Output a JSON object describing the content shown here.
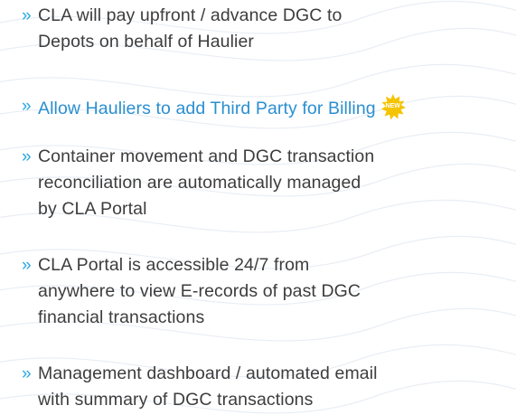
{
  "features": {
    "items": [
      {
        "lines": [
          "CLA will pay upfront / advance DGC to",
          "Depots on behalf of Haulier"
        ]
      },
      {
        "lines": [
          "Allow Hauliers to add Third Party for Billing"
        ],
        "badge": "NEW"
      },
      {
        "lines": [
          "Container movement and DGC transaction",
          "reconciliation are automatically managed",
          "by CLA Portal"
        ]
      },
      {
        "lines": [
          "CLA Portal is accessible 24/7 from",
          "anywhere to view E-records of past DGC",
          "financial transactions"
        ]
      },
      {
        "lines": [
          "Management dashboard / automated email",
          "with summary of DGC transactions"
        ]
      }
    ],
    "bullet_glyph": "»"
  },
  "colors": {
    "text": "#3d3d3d",
    "bullet": "#29a8df",
    "highlight": "#2a8fd1",
    "badge": "#f5c400",
    "background": "#ffffff",
    "waves": "#e9eef4"
  },
  "icons": {
    "bullet": "double-chevron-right",
    "badge": "new-starburst-badge"
  }
}
